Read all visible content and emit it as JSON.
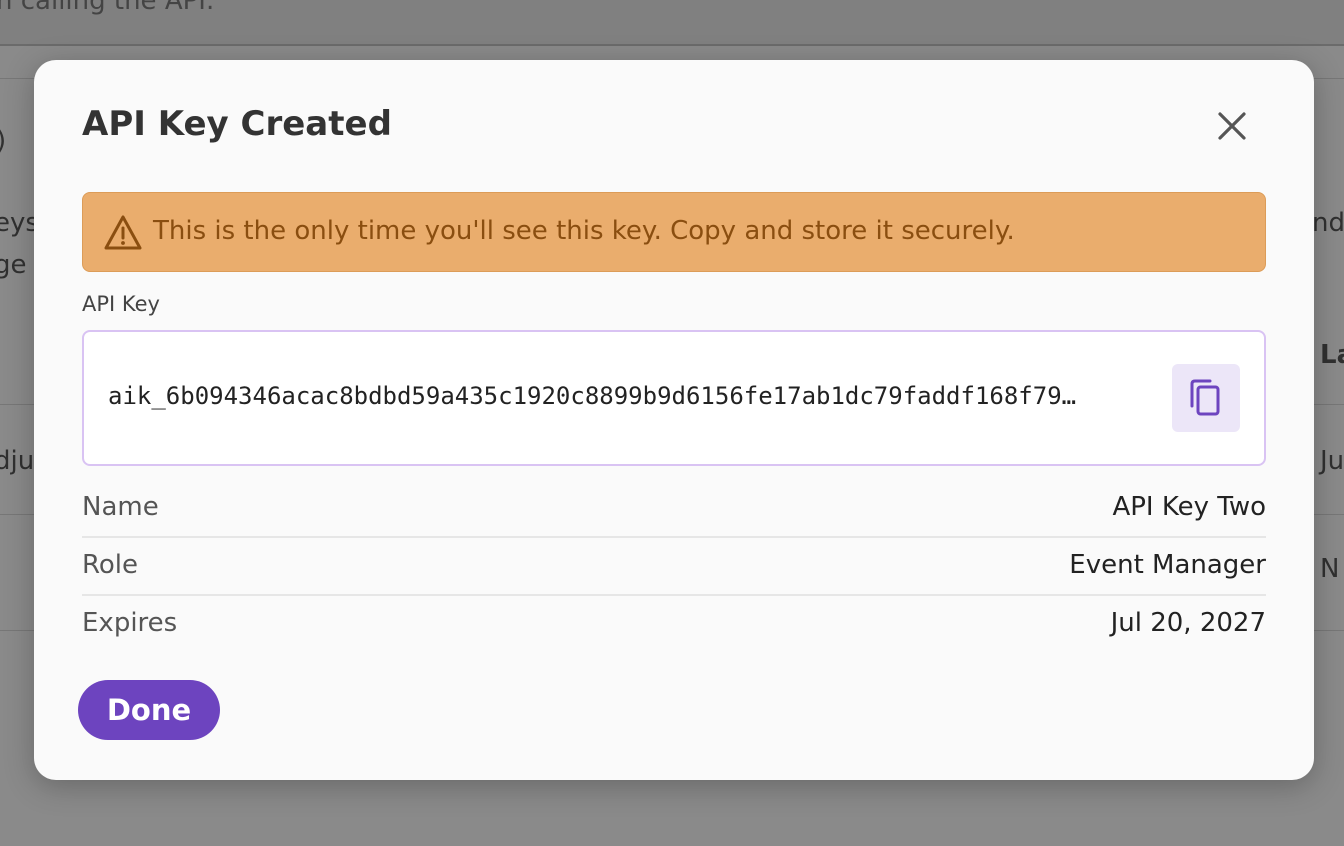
{
  "background": {
    "topbar_text": "n calling the API.",
    "fragments": [
      ")",
      "eys",
      "ge",
      "nd",
      "La",
      "dju",
      "Ju",
      "N"
    ]
  },
  "modal": {
    "title": "API Key Created",
    "close_icon": "close-icon",
    "warning": {
      "icon": "warning-triangle-icon",
      "text": "This is the only time you'll see this key. Copy and store it securely."
    },
    "api_key_label": "API Key",
    "api_key_value": "aik_6b094346acac8bdbd59a435c1920c8899b9d6156fe17ab1dc79faddf168f79…",
    "copy_icon": "copy-icon",
    "details": [
      {
        "label": "Name",
        "value": "API Key Two"
      },
      {
        "label": "Role",
        "value": "Event Manager"
      },
      {
        "label": "Expires",
        "value": "Jul 20, 2027"
      }
    ],
    "done_label": "Done"
  },
  "colors": {
    "accent": "#6d44bf",
    "warning_bg": "#eaad6d",
    "warning_text": "#8a4e10",
    "key_border": "#d9c3f3"
  }
}
